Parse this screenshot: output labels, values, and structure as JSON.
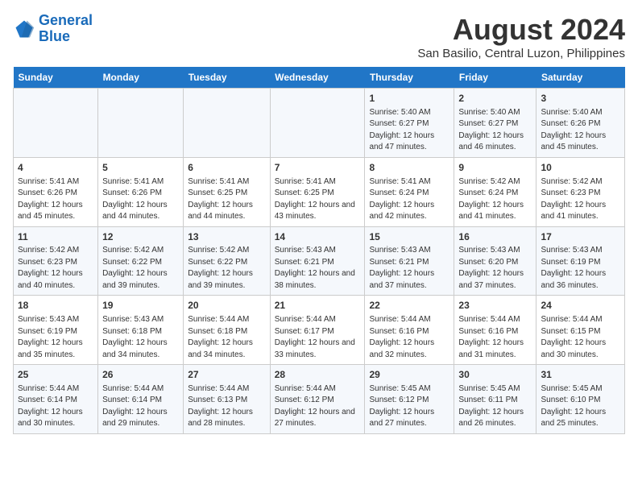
{
  "header": {
    "logo_line1": "General",
    "logo_line2": "Blue",
    "title": "August 2024",
    "subtitle": "San Basilio, Central Luzon, Philippines"
  },
  "weekdays": [
    "Sunday",
    "Monday",
    "Tuesday",
    "Wednesday",
    "Thursday",
    "Friday",
    "Saturday"
  ],
  "weeks": [
    [
      {
        "day": "",
        "content": ""
      },
      {
        "day": "",
        "content": ""
      },
      {
        "day": "",
        "content": ""
      },
      {
        "day": "",
        "content": ""
      },
      {
        "day": "1",
        "content": "Sunrise: 5:40 AM\nSunset: 6:27 PM\nDaylight: 12 hours and 47 minutes."
      },
      {
        "day": "2",
        "content": "Sunrise: 5:40 AM\nSunset: 6:27 PM\nDaylight: 12 hours and 46 minutes."
      },
      {
        "day": "3",
        "content": "Sunrise: 5:40 AM\nSunset: 6:26 PM\nDaylight: 12 hours and 45 minutes."
      }
    ],
    [
      {
        "day": "4",
        "content": "Sunrise: 5:41 AM\nSunset: 6:26 PM\nDaylight: 12 hours and 45 minutes."
      },
      {
        "day": "5",
        "content": "Sunrise: 5:41 AM\nSunset: 6:26 PM\nDaylight: 12 hours and 44 minutes."
      },
      {
        "day": "6",
        "content": "Sunrise: 5:41 AM\nSunset: 6:25 PM\nDaylight: 12 hours and 44 minutes."
      },
      {
        "day": "7",
        "content": "Sunrise: 5:41 AM\nSunset: 6:25 PM\nDaylight: 12 hours and 43 minutes."
      },
      {
        "day": "8",
        "content": "Sunrise: 5:41 AM\nSunset: 6:24 PM\nDaylight: 12 hours and 42 minutes."
      },
      {
        "day": "9",
        "content": "Sunrise: 5:42 AM\nSunset: 6:24 PM\nDaylight: 12 hours and 41 minutes."
      },
      {
        "day": "10",
        "content": "Sunrise: 5:42 AM\nSunset: 6:23 PM\nDaylight: 12 hours and 41 minutes."
      }
    ],
    [
      {
        "day": "11",
        "content": "Sunrise: 5:42 AM\nSunset: 6:23 PM\nDaylight: 12 hours and 40 minutes."
      },
      {
        "day": "12",
        "content": "Sunrise: 5:42 AM\nSunset: 6:22 PM\nDaylight: 12 hours and 39 minutes."
      },
      {
        "day": "13",
        "content": "Sunrise: 5:42 AM\nSunset: 6:22 PM\nDaylight: 12 hours and 39 minutes."
      },
      {
        "day": "14",
        "content": "Sunrise: 5:43 AM\nSunset: 6:21 PM\nDaylight: 12 hours and 38 minutes."
      },
      {
        "day": "15",
        "content": "Sunrise: 5:43 AM\nSunset: 6:21 PM\nDaylight: 12 hours and 37 minutes."
      },
      {
        "day": "16",
        "content": "Sunrise: 5:43 AM\nSunset: 6:20 PM\nDaylight: 12 hours and 37 minutes."
      },
      {
        "day": "17",
        "content": "Sunrise: 5:43 AM\nSunset: 6:19 PM\nDaylight: 12 hours and 36 minutes."
      }
    ],
    [
      {
        "day": "18",
        "content": "Sunrise: 5:43 AM\nSunset: 6:19 PM\nDaylight: 12 hours and 35 minutes."
      },
      {
        "day": "19",
        "content": "Sunrise: 5:43 AM\nSunset: 6:18 PM\nDaylight: 12 hours and 34 minutes."
      },
      {
        "day": "20",
        "content": "Sunrise: 5:44 AM\nSunset: 6:18 PM\nDaylight: 12 hours and 34 minutes."
      },
      {
        "day": "21",
        "content": "Sunrise: 5:44 AM\nSunset: 6:17 PM\nDaylight: 12 hours and 33 minutes."
      },
      {
        "day": "22",
        "content": "Sunrise: 5:44 AM\nSunset: 6:16 PM\nDaylight: 12 hours and 32 minutes."
      },
      {
        "day": "23",
        "content": "Sunrise: 5:44 AM\nSunset: 6:16 PM\nDaylight: 12 hours and 31 minutes."
      },
      {
        "day": "24",
        "content": "Sunrise: 5:44 AM\nSunset: 6:15 PM\nDaylight: 12 hours and 30 minutes."
      }
    ],
    [
      {
        "day": "25",
        "content": "Sunrise: 5:44 AM\nSunset: 6:14 PM\nDaylight: 12 hours and 30 minutes."
      },
      {
        "day": "26",
        "content": "Sunrise: 5:44 AM\nSunset: 6:14 PM\nDaylight: 12 hours and 29 minutes."
      },
      {
        "day": "27",
        "content": "Sunrise: 5:44 AM\nSunset: 6:13 PM\nDaylight: 12 hours and 28 minutes."
      },
      {
        "day": "28",
        "content": "Sunrise: 5:44 AM\nSunset: 6:12 PM\nDaylight: 12 hours and 27 minutes."
      },
      {
        "day": "29",
        "content": "Sunrise: 5:45 AM\nSunset: 6:12 PM\nDaylight: 12 hours and 27 minutes."
      },
      {
        "day": "30",
        "content": "Sunrise: 5:45 AM\nSunset: 6:11 PM\nDaylight: 12 hours and 26 minutes."
      },
      {
        "day": "31",
        "content": "Sunrise: 5:45 AM\nSunset: 6:10 PM\nDaylight: 12 hours and 25 minutes."
      }
    ]
  ]
}
